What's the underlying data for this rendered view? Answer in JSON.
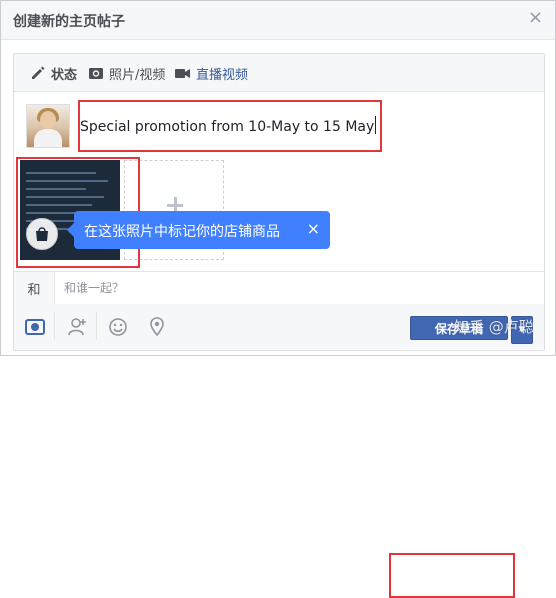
{
  "dialog": {
    "title": "创建新的主页帖子",
    "close_glyph": "×"
  },
  "tabs": [
    {
      "label": "状态",
      "icon": "pencil-icon"
    },
    {
      "label": "照片/视频",
      "icon": "camera-icon"
    },
    {
      "label": "直播视频",
      "icon": "video-camera-icon"
    }
  ],
  "post": {
    "text": "Special promotion from 10-May to 15 May"
  },
  "photo_tooltip": {
    "text": "在这张照片中标记你的店铺商品",
    "close_glyph": "×"
  },
  "with_field": {
    "label": "和",
    "placeholder": "和谁一起？"
  },
  "actions": {
    "icons": [
      "photo-icon",
      "tag-people-icon",
      "feeling-icon",
      "location-icon"
    ],
    "save_label": "保存草稿",
    "dropdown_glyph": "▼"
  },
  "watermark": {
    "text": "知乎 @卢聪"
  },
  "colors": {
    "highlight": "#e0363c",
    "primary_button": "#4267b2",
    "tooltip": "#4080ff"
  }
}
